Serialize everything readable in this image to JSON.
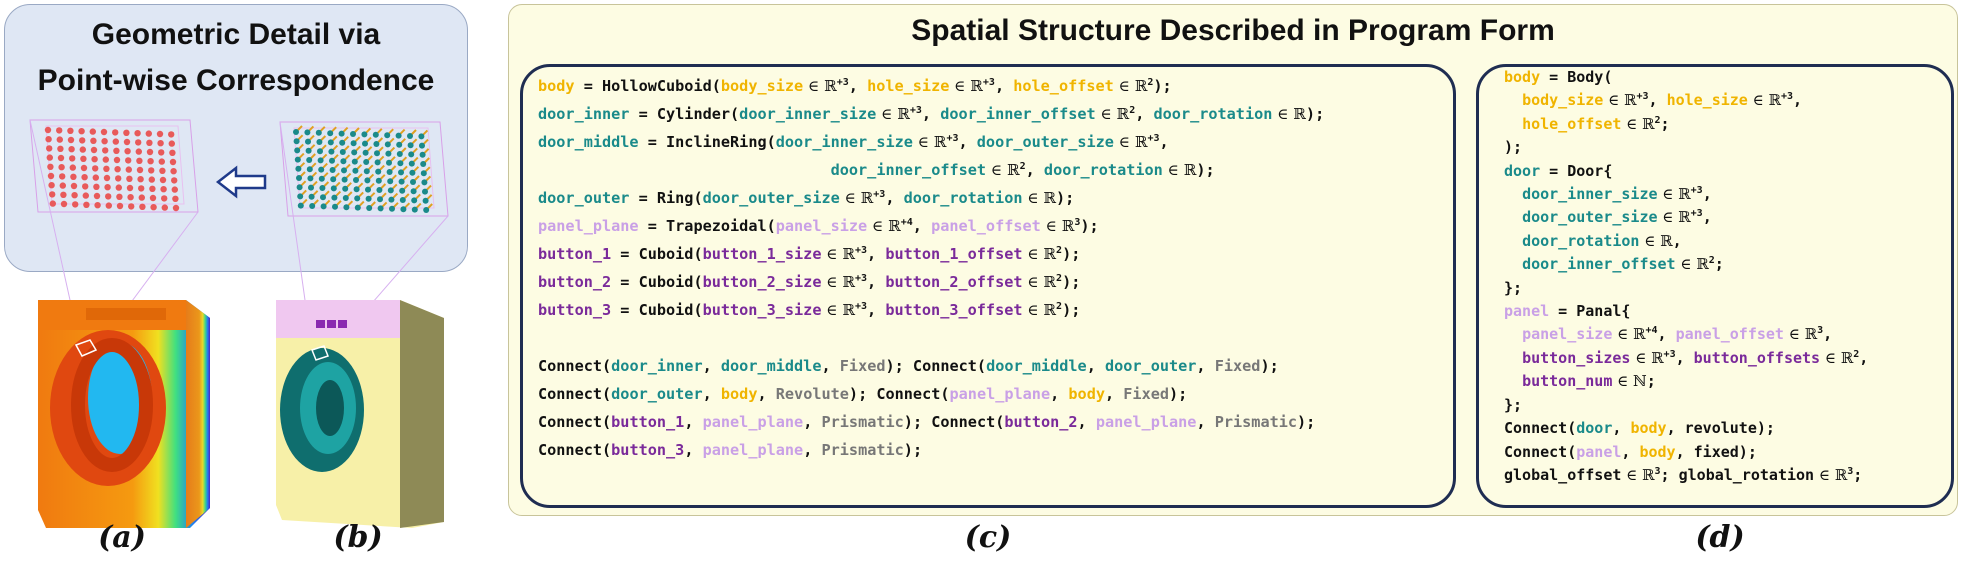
{
  "left": {
    "title_line1": "Geometric Detail via",
    "title_line2": "Point-wise Correspondence",
    "caption_a": "(a)",
    "caption_b": "(b)"
  },
  "right": {
    "title": "Spatial Structure Described in Program Form",
    "caption_c": "(c)",
    "caption_d": "(d)"
  },
  "colors": {
    "keyword": "#111111",
    "body": "#f0b400",
    "door": "#1a8a8a",
    "panel": "#c9a0e6",
    "button": "#7a2a9a",
    "joint": "#777777"
  },
  "program_c": [
    [
      [
        "y",
        "body"
      ],
      [
        "k",
        " = HollowCuboid("
      ],
      [
        "y",
        "body_size"
      ],
      [
        "m",
        " ∈ ℝ"
      ],
      [
        "sup",
        "+3"
      ],
      [
        "k",
        ", "
      ],
      [
        "y",
        "hole_size"
      ],
      [
        "m",
        " ∈ ℝ"
      ],
      [
        "sup",
        "+3"
      ],
      [
        "k",
        ", "
      ],
      [
        "y",
        "hole_offset"
      ],
      [
        "m",
        " ∈ ℝ"
      ],
      [
        "sup",
        "2"
      ],
      [
        "k",
        ");"
      ]
    ],
    [
      [
        "t",
        "door_inner"
      ],
      [
        "k",
        " = Cylinder("
      ],
      [
        "t",
        "door_inner_size"
      ],
      [
        "m",
        " ∈ ℝ"
      ],
      [
        "sup",
        "+3"
      ],
      [
        "k",
        ", "
      ],
      [
        "t",
        "door_inner_offset"
      ],
      [
        "m",
        " ∈ ℝ"
      ],
      [
        "sup",
        "2"
      ],
      [
        "k",
        ", "
      ],
      [
        "t",
        "door_rotation"
      ],
      [
        "m",
        " ∈ ℝ"
      ],
      [
        "k",
        ");"
      ]
    ],
    [
      [
        "t",
        "door_middle"
      ],
      [
        "k",
        " = InclineRing("
      ],
      [
        "t",
        "door_inner_size"
      ],
      [
        "m",
        " ∈ ℝ"
      ],
      [
        "sup",
        "+3"
      ],
      [
        "k",
        ", "
      ],
      [
        "t",
        "door_outer_size"
      ],
      [
        "m",
        " ∈ ℝ"
      ],
      [
        "sup",
        "+3"
      ],
      [
        "k",
        ","
      ]
    ],
    [
      [
        "k",
        "                                "
      ],
      [
        "t",
        "door_inner_offset"
      ],
      [
        "m",
        " ∈ ℝ"
      ],
      [
        "sup",
        "2"
      ],
      [
        "k",
        ", "
      ],
      [
        "t",
        "door_rotation"
      ],
      [
        "m",
        " ∈ ℝ"
      ],
      [
        "k",
        ");"
      ]
    ],
    [
      [
        "t",
        "door_outer"
      ],
      [
        "k",
        " = Ring("
      ],
      [
        "t",
        "door_outer_size"
      ],
      [
        "m",
        " ∈ ℝ"
      ],
      [
        "sup",
        "+3"
      ],
      [
        "k",
        ", "
      ],
      [
        "t",
        "door_rotation"
      ],
      [
        "m",
        " ∈ ℝ"
      ],
      [
        "k",
        ");"
      ]
    ],
    [
      [
        "p",
        "panel_plane"
      ],
      [
        "k",
        " = Trapezoidal("
      ],
      [
        "p",
        "panel_size"
      ],
      [
        "m",
        " ∈ ℝ"
      ],
      [
        "sup",
        "+4"
      ],
      [
        "k",
        ", "
      ],
      [
        "p",
        "panel_offset"
      ],
      [
        "m",
        " ∈ ℝ"
      ],
      [
        "sup",
        "3"
      ],
      [
        "k",
        ");"
      ]
    ],
    [
      [
        "v",
        "button_1"
      ],
      [
        "k",
        " = Cuboid("
      ],
      [
        "v",
        "button_1_size"
      ],
      [
        "m",
        " ∈ ℝ"
      ],
      [
        "sup",
        "+3"
      ],
      [
        "k",
        ", "
      ],
      [
        "v",
        "button_1_offset"
      ],
      [
        "m",
        " ∈ ℝ"
      ],
      [
        "sup",
        "2"
      ],
      [
        "k",
        ");"
      ]
    ],
    [
      [
        "v",
        "button_2"
      ],
      [
        "k",
        " = Cuboid("
      ],
      [
        "v",
        "button_2_size"
      ],
      [
        "m",
        " ∈ ℝ"
      ],
      [
        "sup",
        "+3"
      ],
      [
        "k",
        ", "
      ],
      [
        "v",
        "button_2_offset"
      ],
      [
        "m",
        " ∈ ℝ"
      ],
      [
        "sup",
        "2"
      ],
      [
        "k",
        ");"
      ]
    ],
    [
      [
        "v",
        "button_3"
      ],
      [
        "k",
        " = Cuboid("
      ],
      [
        "v",
        "button_3_size"
      ],
      [
        "m",
        " ∈ ℝ"
      ],
      [
        "sup",
        "+3"
      ],
      [
        "k",
        ", "
      ],
      [
        "v",
        "button_3_offset"
      ],
      [
        "m",
        " ∈ ℝ"
      ],
      [
        "sup",
        "2"
      ],
      [
        "k",
        ");"
      ]
    ],
    [
      [
        "k",
        " "
      ]
    ],
    [
      [
        "k",
        "Connect("
      ],
      [
        "t",
        "door_inner"
      ],
      [
        "k",
        ", "
      ],
      [
        "t",
        "door_middle"
      ],
      [
        "k",
        ", "
      ],
      [
        "g",
        "Fixed"
      ],
      [
        "k",
        "); Connect("
      ],
      [
        "t",
        "door_middle"
      ],
      [
        "k",
        ", "
      ],
      [
        "t",
        "door_outer"
      ],
      [
        "k",
        ", "
      ],
      [
        "g",
        "Fixed"
      ],
      [
        "k",
        ");"
      ]
    ],
    [
      [
        "k",
        "Connect("
      ],
      [
        "t",
        "door_outer"
      ],
      [
        "k",
        ", "
      ],
      [
        "y",
        "body"
      ],
      [
        "k",
        ", "
      ],
      [
        "g",
        "Revolute"
      ],
      [
        "k",
        "); Connect("
      ],
      [
        "p",
        "panel_plane"
      ],
      [
        "k",
        ", "
      ],
      [
        "y",
        "body"
      ],
      [
        "k",
        ", "
      ],
      [
        "g",
        "Fixed"
      ],
      [
        "k",
        ");"
      ]
    ],
    [
      [
        "k",
        "Connect("
      ],
      [
        "v",
        "button_1"
      ],
      [
        "k",
        ", "
      ],
      [
        "p",
        "panel_plane"
      ],
      [
        "k",
        ", "
      ],
      [
        "g",
        "Prismatic"
      ],
      [
        "k",
        "); Connect("
      ],
      [
        "v",
        "button_2"
      ],
      [
        "k",
        ", "
      ],
      [
        "p",
        "panel_plane"
      ],
      [
        "k",
        ", "
      ],
      [
        "g",
        "Prismatic"
      ],
      [
        "k",
        ");"
      ]
    ],
    [
      [
        "k",
        "Connect("
      ],
      [
        "v",
        "button_3"
      ],
      [
        "k",
        ", "
      ],
      [
        "p",
        "panel_plane"
      ],
      [
        "k",
        ", "
      ],
      [
        "g",
        "Prismatic"
      ],
      [
        "k",
        ");"
      ]
    ]
  ],
  "program_d": [
    [
      [
        "y",
        "body"
      ],
      [
        "k",
        " = Body("
      ]
    ],
    [
      [
        "k",
        "  "
      ],
      [
        "y",
        "body_size"
      ],
      [
        "m",
        " ∈ ℝ"
      ],
      [
        "sup",
        "+3"
      ],
      [
        "k",
        ", "
      ],
      [
        "y",
        "hole_size"
      ],
      [
        "m",
        " ∈ ℝ"
      ],
      [
        "sup",
        "+3"
      ],
      [
        "k",
        ","
      ]
    ],
    [
      [
        "k",
        "  "
      ],
      [
        "y",
        "hole_offset"
      ],
      [
        "m",
        " ∈ ℝ"
      ],
      [
        "sup",
        "2"
      ],
      [
        "k",
        ";"
      ]
    ],
    [
      [
        "k",
        ");"
      ]
    ],
    [
      [
        "t",
        "door"
      ],
      [
        "k",
        " = Door{"
      ]
    ],
    [
      [
        "k",
        "  "
      ],
      [
        "t",
        "door_inner_size"
      ],
      [
        "m",
        " ∈ ℝ"
      ],
      [
        "sup",
        "+3"
      ],
      [
        "k",
        ","
      ]
    ],
    [
      [
        "k",
        "  "
      ],
      [
        "t",
        "door_outer_size"
      ],
      [
        "m",
        " ∈ ℝ"
      ],
      [
        "sup",
        "+3"
      ],
      [
        "k",
        ","
      ]
    ],
    [
      [
        "k",
        "  "
      ],
      [
        "t",
        "door_rotation"
      ],
      [
        "m",
        " ∈ ℝ"
      ],
      [
        "k",
        ","
      ]
    ],
    [
      [
        "k",
        "  "
      ],
      [
        "t",
        "door_inner_offset"
      ],
      [
        "m",
        " ∈ ℝ"
      ],
      [
        "sup",
        "2"
      ],
      [
        "k",
        ";"
      ]
    ],
    [
      [
        "k",
        "};"
      ]
    ],
    [
      [
        "p",
        "panel"
      ],
      [
        "k",
        " = Panal{"
      ]
    ],
    [
      [
        "k",
        "  "
      ],
      [
        "p",
        "panel_size"
      ],
      [
        "m",
        " ∈ ℝ"
      ],
      [
        "sup",
        "+4"
      ],
      [
        "k",
        ", "
      ],
      [
        "p",
        "panel_offset"
      ],
      [
        "m",
        " ∈ ℝ"
      ],
      [
        "sup",
        "3"
      ],
      [
        "k",
        ","
      ]
    ],
    [
      [
        "k",
        "  "
      ],
      [
        "v",
        "button_sizes"
      ],
      [
        "m",
        " ∈ ℝ"
      ],
      [
        "sup",
        "+3"
      ],
      [
        "k",
        ", "
      ],
      [
        "v",
        "button_offsets"
      ],
      [
        "m",
        " ∈ ℝ"
      ],
      [
        "sup",
        "2"
      ],
      [
        "k",
        ","
      ]
    ],
    [
      [
        "k",
        "  "
      ],
      [
        "v",
        "button_num"
      ],
      [
        "m",
        " ∈ ℕ"
      ],
      [
        "k",
        ";"
      ]
    ],
    [
      [
        "k",
        "};"
      ]
    ],
    [
      [
        "k",
        "Connect("
      ],
      [
        "t",
        "door"
      ],
      [
        "k",
        ", "
      ],
      [
        "y",
        "body"
      ],
      [
        "k",
        ", revolute);"
      ]
    ],
    [
      [
        "k",
        "Connect("
      ],
      [
        "p",
        "panel"
      ],
      [
        "k",
        ", "
      ],
      [
        "y",
        "body"
      ],
      [
        "k",
        ", fixed);"
      ]
    ],
    [
      [
        "k",
        "global_offset"
      ],
      [
        "m",
        " ∈ ℝ"
      ],
      [
        "sup",
        "3"
      ],
      [
        "k",
        "; global_rotation"
      ],
      [
        "m",
        " ∈ ℝ"
      ],
      [
        "sup",
        "3"
      ],
      [
        "k",
        ";"
      ]
    ]
  ]
}
